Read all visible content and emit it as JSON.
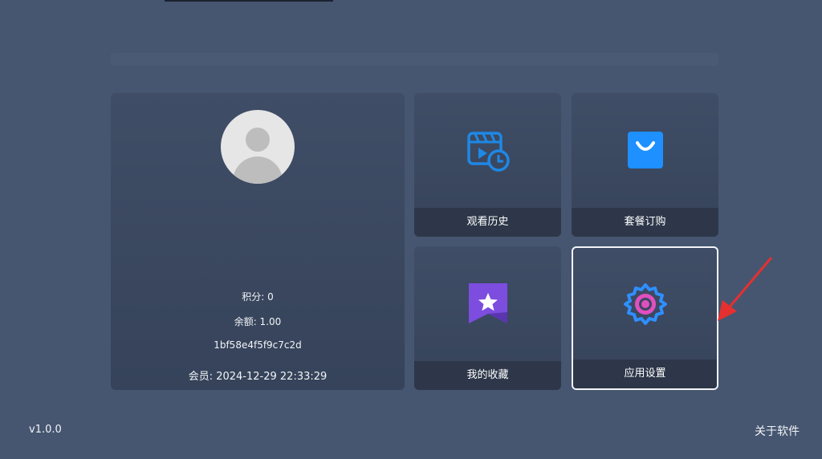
{
  "profile": {
    "points": "积分: 0",
    "balance": "余额: 1.00",
    "device_id": "1bf58e4f5f9c7c2d",
    "member": "会员: 2024-12-29 22:33:29"
  },
  "tiles": {
    "history": {
      "label": "观看历史",
      "icon": "video-history-icon",
      "color": "#1e88e5"
    },
    "package": {
      "label": "套餐订购",
      "icon": "shopping-bag-icon",
      "color": "#1e90ff"
    },
    "favorites": {
      "label": "我的收藏",
      "icon": "star-bookmark-icon",
      "color": "#7c4ddf"
    },
    "settings": {
      "label": "应用设置",
      "icon": "gear-icon",
      "color": "#2f8fff",
      "selected": true
    }
  },
  "footer": {
    "version": "v1.0.0",
    "about": "关于软件"
  },
  "annotation": {
    "arrow_color": "#e53030"
  }
}
